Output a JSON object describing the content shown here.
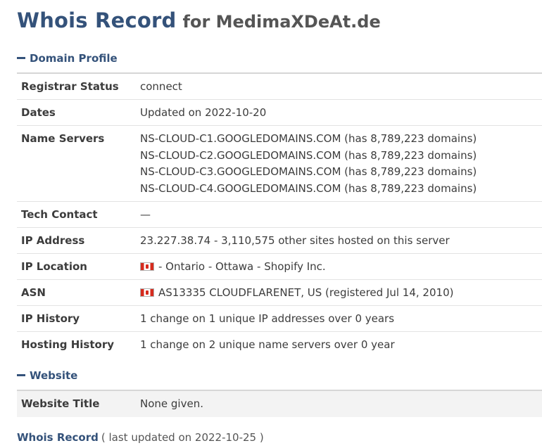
{
  "header": {
    "title": "Whois Record",
    "subtitle": "for MedimaXDeAt.de"
  },
  "domain_profile": {
    "heading": "Domain Profile",
    "rows": [
      {
        "label": "Registrar Status",
        "value": "connect"
      },
      {
        "label": "Dates",
        "value": "Updated on 2022-10-20"
      },
      {
        "label": "Name Servers",
        "lines": [
          "NS-CLOUD-C1.GOOGLEDOMAINS.COM (has 8,789,223 domains)",
          "NS-CLOUD-C2.GOOGLEDOMAINS.COM (has 8,789,223 domains)",
          "NS-CLOUD-C3.GOOGLEDOMAINS.COM (has 8,789,223 domains)",
          "NS-CLOUD-C4.GOOGLEDOMAINS.COM (has 8,789,223 domains)"
        ]
      },
      {
        "label": "Tech Contact",
        "value": "—"
      },
      {
        "label": "IP Address",
        "value": "23.227.38.74 - 3,110,575 other sites hosted on this server"
      },
      {
        "label": "IP Location",
        "value": "- Ontario - Ottawa - Shopify Inc.",
        "flag": "canada-flag-icon"
      },
      {
        "label": "ASN",
        "value": "AS13335 CLOUDFLARENET, US (registered Jul 14, 2010)",
        "flag": "canada-flag-icon"
      },
      {
        "label": "IP History",
        "value": "1 change on 1 unique IP addresses over 0 years"
      },
      {
        "label": "Hosting History",
        "value": "1 change on 2 unique name servers over 0 year"
      }
    ]
  },
  "website": {
    "heading": "Website",
    "rows": [
      {
        "label": "Website Title",
        "value": "None given."
      }
    ]
  },
  "footer": {
    "link": "Whois Record",
    "note": "( last updated on 2022-10-25 )"
  },
  "colors": {
    "heading_blue": "#34527a",
    "text": "#3c3c3c",
    "flag_red": "#d52b1e"
  }
}
